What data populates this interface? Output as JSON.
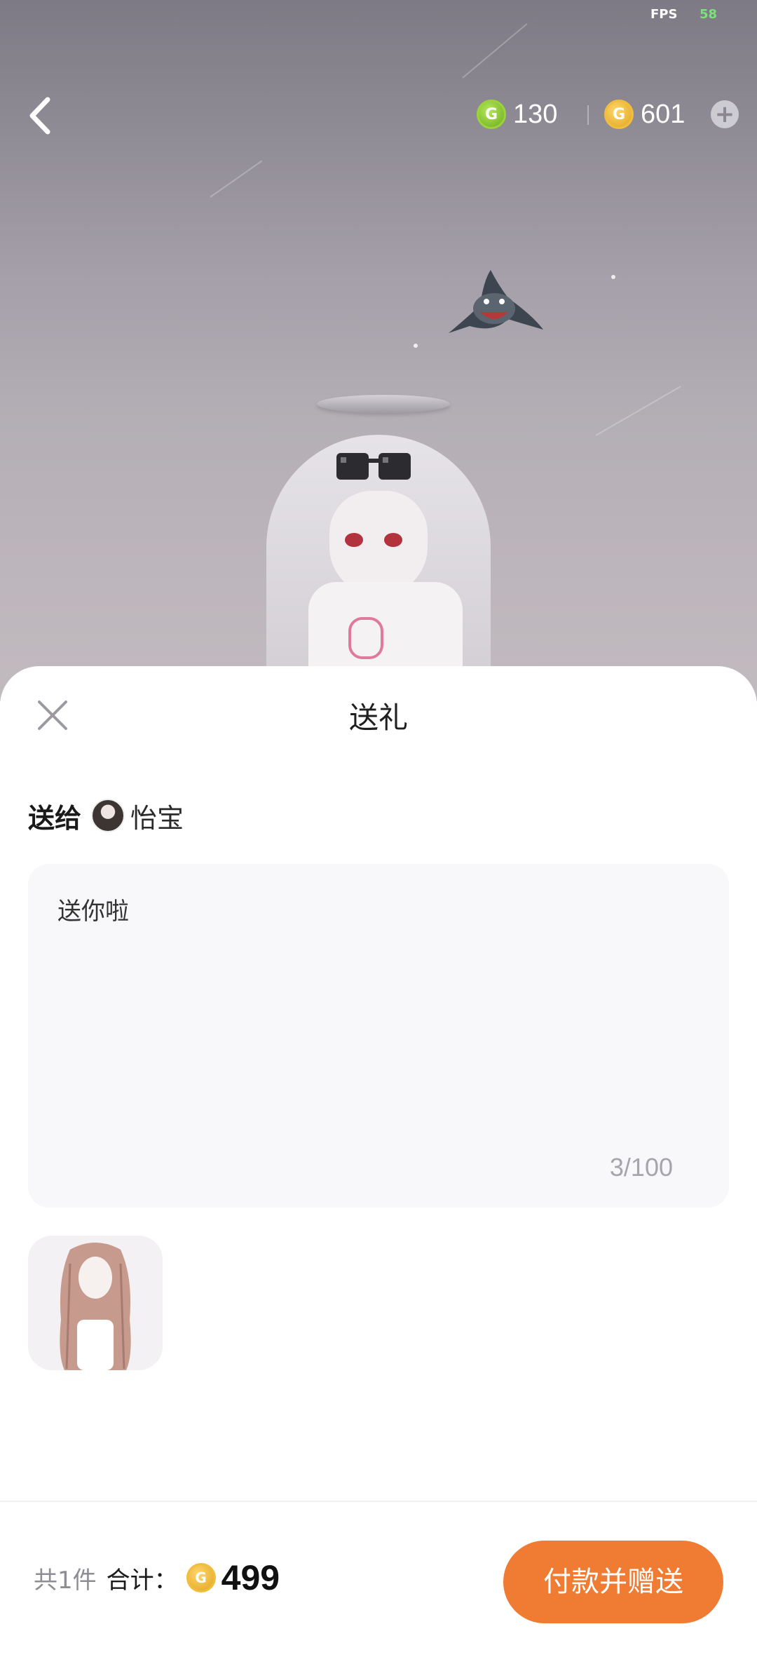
{
  "hud": {
    "fps_label": "FPS",
    "fps_value": "58",
    "green_currency": "130",
    "gold_currency": "601",
    "colors": {
      "green_coin": "#8cc63f",
      "gold_coin": "#f0be3c"
    }
  },
  "sheet": {
    "title": "送礼",
    "recipient_label": "送给",
    "recipient_name": "怡宝",
    "message": "送你啦",
    "char_count": "3/100",
    "summary": {
      "count_text": "共1件",
      "total_label": "合计：",
      "price": "499"
    },
    "pay_button": "付款并赠送",
    "colors": {
      "accent": "#f07c33",
      "message_bg": "#f8f7f9"
    }
  },
  "icons": {
    "back": "chevron-left-icon",
    "plus": "plus-icon",
    "close": "close-icon",
    "coin": "g-coin-icon"
  }
}
